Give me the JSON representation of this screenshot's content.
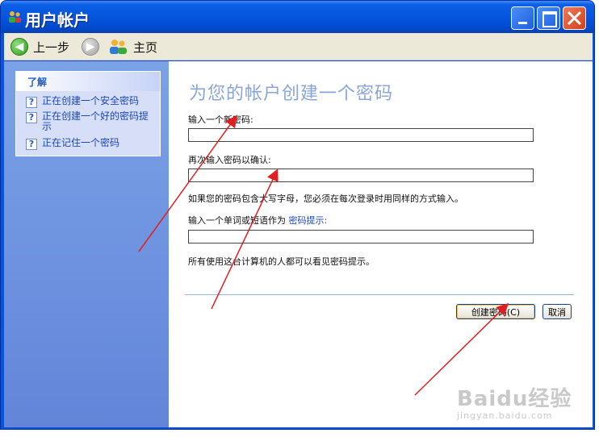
{
  "window": {
    "title": "用户帐户"
  },
  "toolbar": {
    "back_label": "上一步",
    "home_label": "主页"
  },
  "sidebar": {
    "header": "了解",
    "items": [
      {
        "label": "正在创建一个安全密码"
      },
      {
        "label": "正在创建一个好的密码提示"
      },
      {
        "label": "正在记住一个密码"
      }
    ]
  },
  "main": {
    "heading": "为您的帐户创建一个密码",
    "new_password_label": "输入一个新密码:",
    "new_password_value": "",
    "confirm_label": "再次输入密码以确认:",
    "confirm_value": "",
    "case_notice": "如果您的密码包含大写字母，您必须在每次登录时用同样的方式输入。",
    "hint_label_prefix": "输入一个单词或短语作为",
    "hint_link": "密码提示:",
    "hint_value": "",
    "hint_notice": "所有使用这台计算机的人都可以看见密码提示。",
    "create_button": "创建密码(C)",
    "cancel_button": "取消"
  },
  "watermark": {
    "main": "Baidu经验",
    "sub": "jingyan.baidu.com"
  },
  "colors": {
    "title_bar": "#0655dd",
    "sidebar_gradient_top": "#7ba2e7",
    "heading_text": "#8aa5d8",
    "annotation": "#e02020"
  }
}
